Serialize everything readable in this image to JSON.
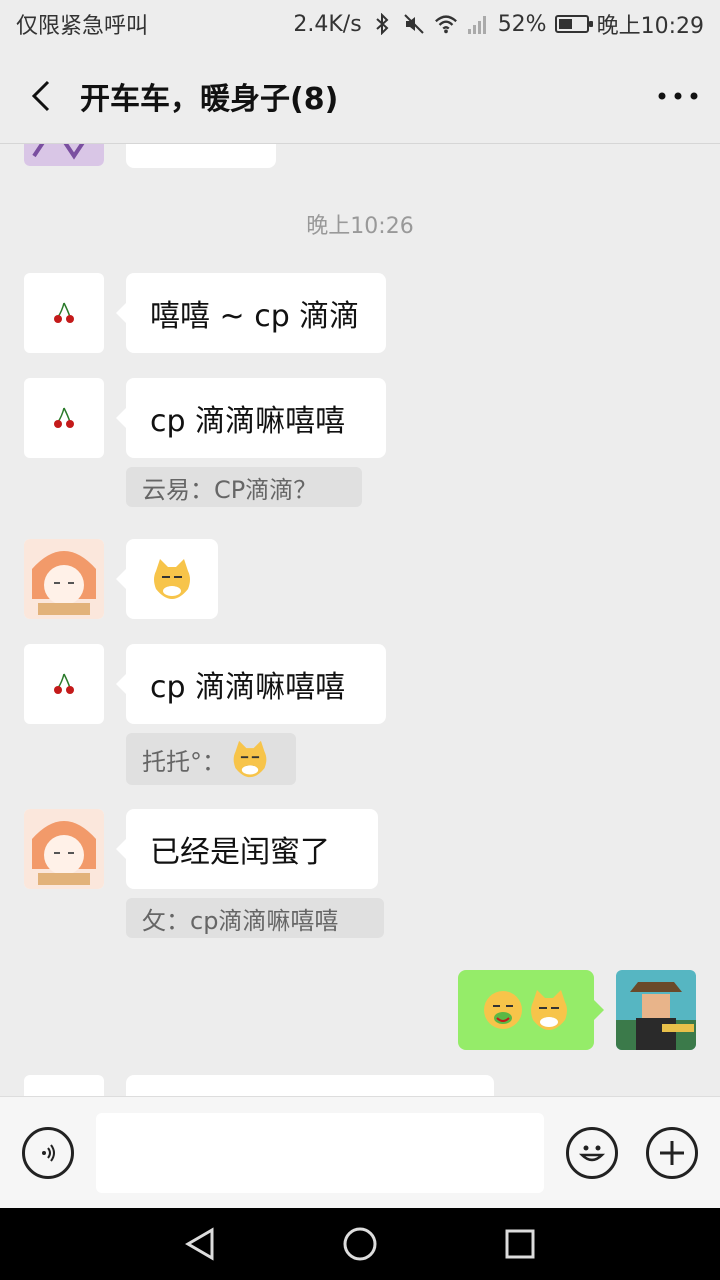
{
  "status_bar": {
    "left_text": "仅限紧急呼叫",
    "speed": "2.4K/s",
    "battery_percent": "52%",
    "battery_level": 0.52,
    "time": "晚上10:29",
    "icons": [
      "bluetooth-icon",
      "mute-icon",
      "wifi-icon",
      "signal-icon",
      "battery-icon"
    ]
  },
  "header": {
    "title": "开车车，暖身子(8)"
  },
  "chat": {
    "timestamp": "晚上10:26",
    "messages": [
      {
        "side": "left",
        "avatar": "cherry",
        "text": "嘻嘻 ~ cp 滴滴"
      },
      {
        "side": "left",
        "avatar": "cherry",
        "text": "cp 滴滴嘛嘻嘻",
        "quote": "云易：CP滴滴？"
      },
      {
        "side": "left",
        "avatar": "anime-girl",
        "sticker": "cat-smirk"
      },
      {
        "side": "left",
        "avatar": "cherry",
        "text": "cp 滴滴嘛嘻嘻",
        "quote": "托托°："
      },
      {
        "side": "left",
        "avatar": "anime-girl",
        "text": "已经是闰蜜了",
        "quote": "攵：cp滴滴嘛嘻嘻"
      },
      {
        "side": "right",
        "avatar": "game-character",
        "stickers": [
          "vomit-face",
          "cat-smirk"
        ]
      }
    ]
  },
  "input_bar": {
    "placeholder": "",
    "value": ""
  },
  "colors": {
    "background": "#ededed",
    "bubble_left": "#ffffff",
    "bubble_right": "#95ec69",
    "quote_bg": "#e0e0e0"
  }
}
